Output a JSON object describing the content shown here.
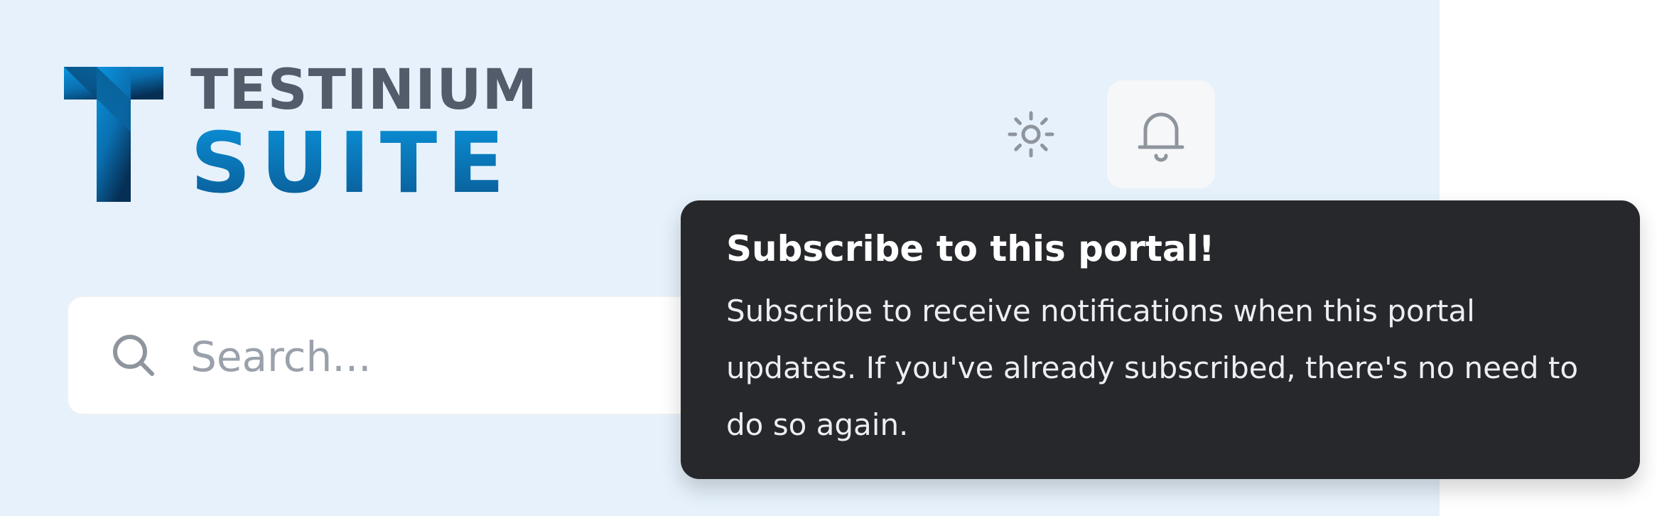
{
  "logo": {
    "line1": "TESTINIUM",
    "line2": "SUITE",
    "colors": {
      "gray": "#525c6b",
      "blue_light": "#0a8fd6",
      "blue_dark": "#0a3f6e"
    }
  },
  "header": {
    "theme_toggle_icon": "sun-icon",
    "notifications_icon": "bell-icon"
  },
  "search": {
    "icon": "search-icon",
    "placeholder": "Search...",
    "value": ""
  },
  "tooltip": {
    "title": "Subscribe to this portal!",
    "body": "Subscribe to receive notifications when this portal updates. If you've already subscribed, there's no need to do so again."
  },
  "colors": {
    "sidebar_bg": "#e6f1fb",
    "tooltip_bg": "#27282b",
    "button_bg": "#f6f7f9"
  }
}
